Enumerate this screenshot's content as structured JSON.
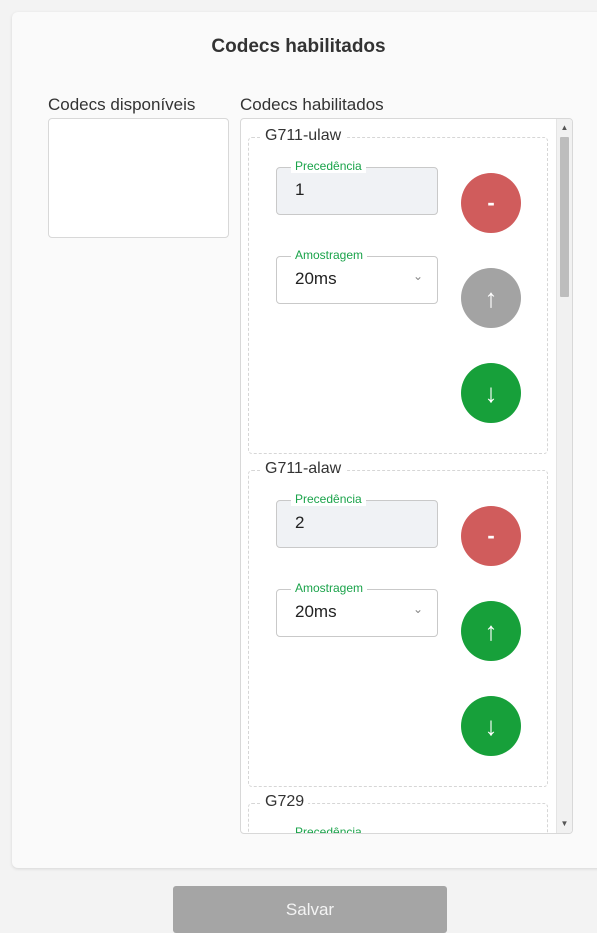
{
  "title": "Codecs habilitados",
  "available": {
    "label": "Codecs disponíveis"
  },
  "enabled": {
    "label": "Codecs habilitados",
    "codecs": [
      {
        "name": "G711-ulaw",
        "precedence_label": "Precedência",
        "precedence_value": "1",
        "sampling_label": "Amostragem",
        "sampling_value": "20ms",
        "remove": "-",
        "up": "↑",
        "down": "↓"
      },
      {
        "name": "G711-alaw",
        "precedence_label": "Precedência",
        "precedence_value": "2",
        "sampling_label": "Amostragem",
        "sampling_value": "20ms",
        "remove": "-",
        "up": "↑",
        "down": "↓"
      },
      {
        "name": "G729",
        "precedence_label": "Precedência"
      }
    ]
  },
  "save_label": "Salvar",
  "icons": {
    "select": "chevron-down-icon",
    "scroll_up": "scroll-up-icon",
    "scroll_down": "scroll-down-icon"
  },
  "colors": {
    "remove": "#d05c5c",
    "move_enabled": "#17a03a",
    "move_disabled": "#a3a3a3",
    "legend": "#1aa34a",
    "save": "#a5a5a5"
  }
}
